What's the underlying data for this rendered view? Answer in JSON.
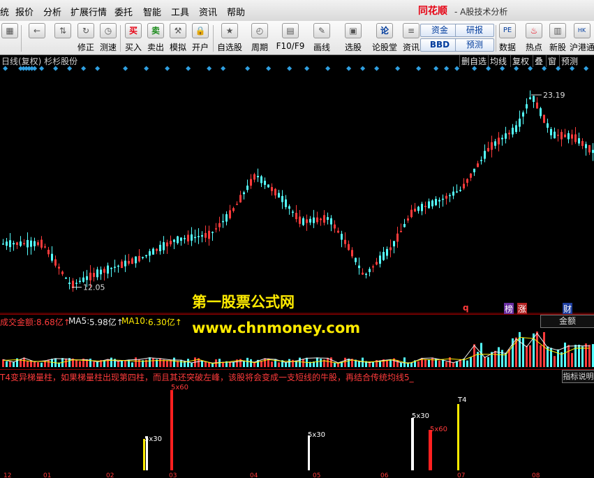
{
  "menu": {
    "items": [
      "统",
      "报价",
      "分析",
      "扩展行情",
      "委托",
      "智能",
      "工具",
      "资讯",
      "帮助"
    ],
    "brand": "同花顺",
    "brand_sub": "- A股技术分析"
  },
  "toolbar": {
    "buttons": [
      {
        "label": "修正",
        "icon": "refresh-icon"
      },
      {
        "label": "测速",
        "icon": "stopwatch-icon"
      },
      {
        "label": "买入",
        "icon": "buy-icon",
        "glyph": "买"
      },
      {
        "label": "卖出",
        "icon": "sell-icon",
        "glyph": "卖"
      },
      {
        "label": "模拟",
        "icon": "hammer-icon"
      },
      {
        "label": "开户",
        "icon": "lock-icon"
      },
      {
        "label": "自选股",
        "icon": "star-icon"
      },
      {
        "label": "周期",
        "icon": "clock-icon"
      },
      {
        "label": "F10/F9",
        "icon": "document-icon"
      },
      {
        "label": "画线",
        "icon": "pencil-icon"
      },
      {
        "label": "选股",
        "icon": "monitor-icon"
      },
      {
        "label": "论股堂",
        "icon": "forum-icon",
        "glyph": "论"
      },
      {
        "label": "资讯",
        "icon": "news-icon"
      },
      {
        "label": "数据",
        "icon": "pe-icon",
        "glyph": "PE"
      },
      {
        "label": "热点",
        "icon": "fire-icon"
      },
      {
        "label": "新股",
        "icon": "newstock-icon"
      },
      {
        "label": "沪港通",
        "icon": "hk-link-icon"
      }
    ],
    "pills": [
      "资金",
      "研报",
      "BBD",
      "预测"
    ]
  },
  "chart_header": {
    "title": "日线(复权)  杉杉股份",
    "tabs": [
      "删自选",
      "均线",
      "复权",
      "叠",
      "窗",
      "预测"
    ]
  },
  "main_chart": {
    "high_label": "23.19",
    "low_label": "12.05",
    "markers": [
      "q",
      "榜",
      "涨",
      "财"
    ]
  },
  "volume_panel": {
    "label_prefix": "成交金额:",
    "amount": "8.68亿↑",
    "ma5_label": "MA5:",
    "ma5": "5.98亿↑",
    "ma10_label": "MA10:",
    "ma10": "6.30亿↑",
    "right_button": "金额"
  },
  "indicator_panel": {
    "description": "T4变异梯量柱，如果梯量柱出现第四柱，而且其还突破左峰，该股将会变成一支短线的牛股，再结合传统均线5_",
    "right_button": "指标说明",
    "labels": [
      "5x30",
      "5x60",
      "5x30",
      "5x30",
      "5x60",
      "T4"
    ]
  },
  "x_axis": {
    "ticks": [
      "12",
      "01",
      "02",
      "03",
      "04",
      "05",
      "06",
      "07",
      "08"
    ]
  },
  "watermark": {
    "line1": "第一股票公式网",
    "line2": "www.chnmoney.com"
  },
  "colors": {
    "up": "#ff3b3b",
    "down": "#54ffff",
    "yellow": "#ffeb00",
    "ma10": "#ffeb00"
  }
}
